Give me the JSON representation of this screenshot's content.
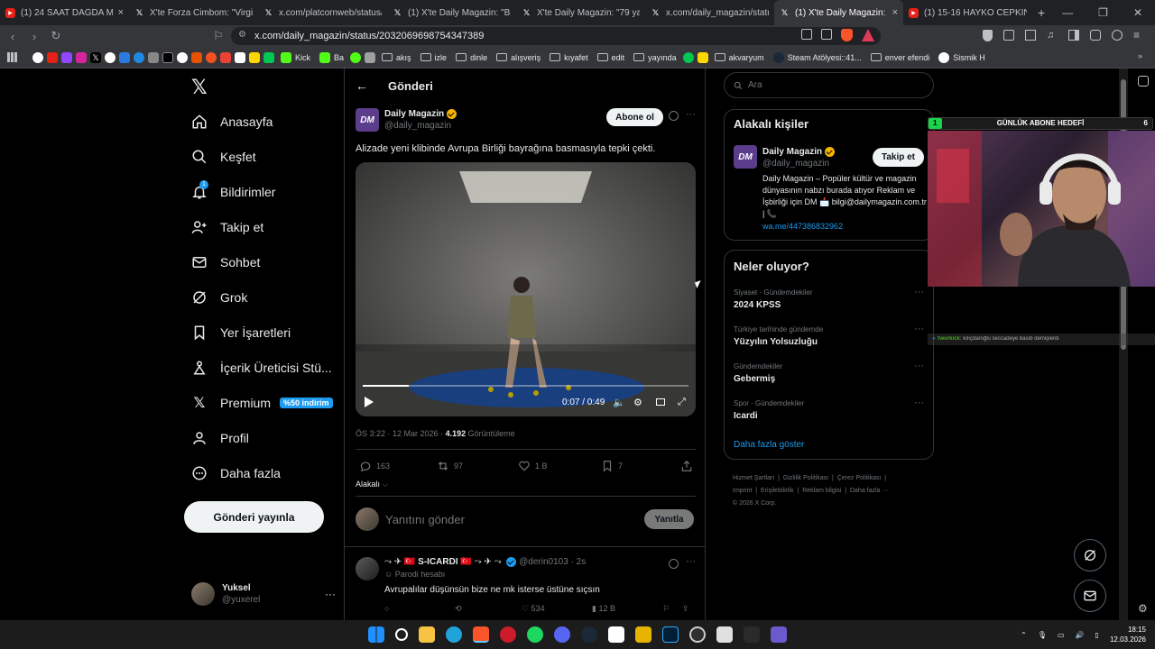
{
  "browser": {
    "tabs": [
      {
        "icon": "youtube-icon",
        "title": "(1) 24 SAAT DAĞDA MAHSUR K",
        "active": false
      },
      {
        "icon": "x-icon",
        "title": "X'te Forza Cimbom: \"Virgil van",
        "active": false
      },
      {
        "icon": "x-icon",
        "title": "x.com/platcornweb/status/203",
        "active": false
      },
      {
        "icon": "x-icon",
        "title": "(1) X'te Daily Magazin: \"Bir içer",
        "active": false
      },
      {
        "icon": "x-icon",
        "title": "X'te Daily Magazin: \"79 yaşında",
        "active": false
      },
      {
        "icon": "x-icon",
        "title": "x.com/daily_magazin/status/20",
        "active": false
      },
      {
        "icon": "x-icon",
        "title": "(1) X'te Daily Magazin: \"Ali",
        "active": true
      },
      {
        "icon": "youtube-icon",
        "title": "(1) 15-16 HAYKO CEPKİN - SOK",
        "active": false
      }
    ],
    "url": "x.com/daily_magazin/status/2032069698754347389",
    "bookmarks": [
      "Kick",
      "Ba",
      "akış",
      "izle",
      "dinle",
      "alışveriş",
      "kıyafet",
      "edit",
      "yayında",
      "akvaryum",
      "Steam Atölyesi::41...",
      "enver efendi",
      "Sismik H"
    ]
  },
  "x_nav": {
    "items": [
      {
        "label": "Anasayfa",
        "icon": "home-icon"
      },
      {
        "label": "Keşfet",
        "icon": "search-icon"
      },
      {
        "label": "Bildirimler",
        "icon": "bell-icon",
        "badge": "1"
      },
      {
        "label": "Takip et",
        "icon": "follow-icon"
      },
      {
        "label": "Sohbet",
        "icon": "mail-icon"
      },
      {
        "label": "Grok",
        "icon": "grok-icon"
      },
      {
        "label": "Yer İşaretleri",
        "icon": "bookmark-icon"
      },
      {
        "label": "İçerik Üreticisi Stü...",
        "icon": "creator-icon"
      },
      {
        "label": "Premium",
        "icon": "x-icon",
        "badge": "%50 indirim"
      },
      {
        "label": "Profil",
        "icon": "profile-icon"
      },
      {
        "label": "Daha fazla",
        "icon": "more-circle-icon"
      }
    ],
    "post_button": "Gönderi yayınla",
    "user": {
      "name": "Yuksel",
      "handle": "@yuxerel"
    }
  },
  "post": {
    "header_title": "Gönderi",
    "author": {
      "name": "Daily Magazin",
      "handle": "@daily_magazin",
      "avatar_text": "DM"
    },
    "subscribe_label": "Abone ol",
    "text": "Alizade yeni klibinde Avrupa Birliği bayrağına basmasıyla tepki çekti.",
    "video": {
      "current": "0:07",
      "duration": "0:49",
      "time_display": "0:07 / 0:49",
      "progress": 0.14
    },
    "meta": {
      "time": "ÖS 3:22 · 12 Mar 2026 ·",
      "views": "4.192",
      "views_label": "Görüntüleme"
    },
    "stats": {
      "replies": "163",
      "reposts": "97",
      "likes": "1 B",
      "bookmarks": "7"
    },
    "related_label": "Alakalı",
    "reply_placeholder": "Yanıtını gönder",
    "reply_button": "Yanıtla"
  },
  "reply": {
    "name": "S-ICARDI",
    "handle": "@derin0103 · 2s",
    "subtitle": "Parodi hesabı",
    "text": "Avrupalılar düşünsün bize ne mk isterse üstüne sıçsın",
    "stats": {
      "likes": "534",
      "views": "12 B"
    }
  },
  "right": {
    "search_placeholder": "Ara",
    "related_title": "Alakalı kişiler",
    "related_user": {
      "name": "Daily Magazin",
      "handle": "@daily_magazin",
      "follow_label": "Takip et",
      "bio": "Daily Magazin – Popüler kültür ve magazin dünyasının nabzı burada atıyor Reklam ve İşbirliği için DM 📩 bilgi@dailymagazin.com.tr | 📞",
      "link": "wa.me/447386832962"
    },
    "trends_title": "Neler oluyor?",
    "trends": [
      {
        "context": "Siyaset · Gündemdekiler",
        "name": "2024 KPSS"
      },
      {
        "context": "Türkiye tarihinde gündemde",
        "name": "Yüzyılın Yolsuzluğu"
      },
      {
        "context": "Gündemdekiler",
        "name": "Gebermiş"
      },
      {
        "context": "Spor · Gündemdekiler",
        "name": "Icardi"
      }
    ],
    "show_more": "Daha fazla göster",
    "footer": [
      "Hizmet Şartları",
      "Gizlilik Politikası",
      "Çerez Politikası",
      "Imprint",
      "Erişilebilirlik",
      "Reklam bilgisi",
      "Daha fazla ···",
      "© 2026 X Corp."
    ]
  },
  "overlay": {
    "goal_label": "GÜNLÜK ABONE HEDEFİ",
    "goal_current": "1",
    "goal_target": "6",
    "goal_fraction": 0.06,
    "chat_user": "Tworkick",
    "chat_text": ": kılıçdaroğlu seccadeye basıb demişlerdi"
  },
  "taskbar": {
    "time": "18:15",
    "date": "12.03.2026"
  },
  "colors": {
    "accent": "#1d9bf0",
    "verified_gold": "#f4b400",
    "goal_green": "#19d44a",
    "premium_badge": "#1d9bf0"
  }
}
